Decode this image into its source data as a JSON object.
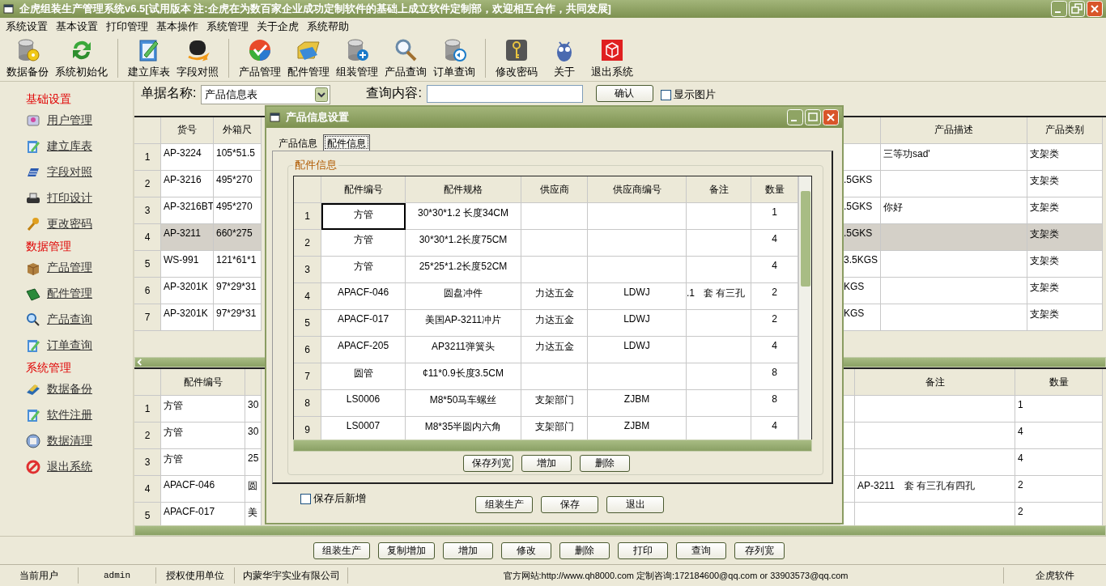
{
  "window": {
    "title": "企虎组装生产管理系统v6.5[试用版本 注:企虎在为数百家企业成功定制软件的基础上成立软件定制部，欢迎相互合作，共同发展]"
  },
  "menu": [
    "系统设置",
    "基本设置",
    "打印管理",
    "基本操作",
    "系统管理",
    "关于企虎",
    "系统帮助"
  ],
  "toolbar_groups": [
    [
      "数据备份",
      "系统初始化"
    ],
    [
      "建立库表",
      "字段对照"
    ],
    [
      "产品管理",
      "配件管理",
      "组装管理",
      "产品查询",
      "订单查询"
    ],
    [
      "修改密码",
      "关于",
      "退出系统"
    ]
  ],
  "sidebar": [
    {
      "title": "基础设置",
      "items": [
        "用户管理",
        "建立库表",
        "字段对照",
        "打印设计",
        "更改密码"
      ]
    },
    {
      "title": "数据管理",
      "items": [
        "产品管理",
        "配件管理",
        "产品查询",
        "订单查询"
      ]
    },
    {
      "title": "系统管理",
      "items": [
        "数据备份",
        "软件注册",
        "数据清理",
        "退出系统"
      ]
    }
  ],
  "query": {
    "doc_label": "单据名称:",
    "doc_value": "产品信息表",
    "search_label": "查询内容:",
    "confirm": "确认",
    "show_images": {
      "label": "显示图片",
      "checked": false
    }
  },
  "top_table": {
    "columns": {
      "item_no": "货号",
      "outer_box_size": "外箱尺",
      "description": "产品描述",
      "category": "产品类别"
    },
    "rows": [
      {
        "number": "1",
        "selected": false,
        "item_no": "AP-3224",
        "outer_box_size": "105*51.5",
        "description": "三等功sad'",
        "category": "支架类"
      },
      {
        "number": "2",
        "selected": false,
        "item_no": "AP-3216",
        "outer_box_size": "495*270",
        "column_4": ".5GKS",
        "category": "支架类"
      },
      {
        "number": "3",
        "selected": false,
        "item_no": "AP-3216BT",
        "outer_box_size": "495*270",
        "column_4": ".5GKS",
        "description": "你好",
        "category": "支架类"
      },
      {
        "number": "4",
        "selected": true,
        "item_no": "AP-3211",
        "outer_box_size": "660*275",
        "column_4": ".5GKS",
        "category": "支架类"
      },
      {
        "number": "5",
        "selected": false,
        "item_no": "WS-991",
        "outer_box_size": "121*61*1",
        "column_4": "3.5KGS",
        "category": "支架类"
      },
      {
        "number": "6",
        "selected": false,
        "item_no": "AP-3201K",
        "outer_box_size": "97*29*31",
        "column_4": "KGS",
        "category": "支架类"
      },
      {
        "number": "7",
        "selected": false,
        "item_no": "AP-3201K",
        "outer_box_size": "97*29*31",
        "column_4": "KGS",
        "category": "支架类"
      }
    ]
  },
  "bottom_table": {
    "columns": {
      "part_no": "配件编号",
      "remarks": "备注",
      "quantity": "数量"
    },
    "rows": [
      {
        "number": "1",
        "part_no": "方管",
        "column_2": "30",
        "quantity": "1"
      },
      {
        "number": "2",
        "part_no": "方管",
        "column_2": "30",
        "quantity": "4"
      },
      {
        "number": "3",
        "part_no": "方管",
        "column_2": "25",
        "quantity": "4"
      },
      {
        "number": "4",
        "part_no": "APACF-046",
        "column_2": "圆",
        "remarks": "AP-3211　套 有三孔有四孔",
        "quantity": "2"
      },
      {
        "number": "5",
        "part_no": "APACF-017",
        "column_2": "美",
        "quantity": "2"
      }
    ]
  },
  "dialog": {
    "title": "产品信息设置",
    "tabs": [
      {
        "label": "产品信息",
        "selected": false
      },
      {
        "label": "配件信息",
        "selected": true
      }
    ],
    "group_label": "配件信息",
    "grid": {
      "columns": [
        "配件编号",
        "配件规格",
        "供应商",
        "供应商编号",
        "备注",
        "数量"
      ],
      "rows": [
        {
          "number": "1",
          "focused": true,
          "cells": [
            "方管",
            "30*30*1.2  长度34CM",
            "",
            "",
            "",
            "1"
          ]
        },
        {
          "number": "2",
          "focused": false,
          "cells": [
            "方管",
            "30*30*1.2长度75CM",
            "",
            "",
            "",
            "4"
          ]
        },
        {
          "number": "3",
          "focused": false,
          "cells": [
            "方管",
            "25*25*1.2长度52CM",
            "",
            "",
            "",
            "4"
          ]
        },
        {
          "number": "4",
          "focused": false,
          "cells": [
            "APACF-046",
            "圆盘冲件",
            "力达五金",
            "LDWJ",
            ".1　套 有三孔",
            "2"
          ]
        },
        {
          "number": "5",
          "focused": false,
          "cells": [
            "APACF-017",
            "美国AP-3211冲片",
            "力达五金",
            "LDWJ",
            "",
            "2"
          ]
        },
        {
          "number": "6",
          "focused": false,
          "cells": [
            "APACF-205",
            "AP3211弹簧头",
            "力达五金",
            "LDWJ",
            "",
            "4"
          ]
        },
        {
          "number": "7",
          "focused": false,
          "cells": [
            "圆管",
            "¢11*0.9长度3.5CM",
            "",
            "",
            "",
            "8"
          ]
        },
        {
          "number": "8",
          "focused": false,
          "cells": [
            "LS0006",
            "M8*50马车螺丝",
            "支架部门",
            "ZJBM",
            "",
            "8"
          ]
        },
        {
          "number": "9",
          "focused": false,
          "cells": [
            "LS0007",
            "M8*35半圆内六角",
            "支架部门",
            "ZJBM",
            "",
            "4"
          ]
        }
      ]
    },
    "grid_buttons": [
      "保存列宽",
      "增加",
      "删除"
    ],
    "save_new": {
      "label": "保存后新增",
      "checked": false
    },
    "buttons": [
      "组装生产",
      "保存",
      "退出"
    ]
  },
  "action_buttons": [
    "组装生产",
    "复制增加",
    "增加",
    "修改",
    "删除",
    "打印",
    "查询",
    "存列宽"
  ],
  "status_bar": [
    "当前用户",
    "admin",
    "授权使用单位",
    "内蒙华宇实业有限公司",
    "官方网站:http://www.qh8000.com 定制咨询:172184600@qq.com or 33903573@qq.com",
    "企虎软件"
  ]
}
